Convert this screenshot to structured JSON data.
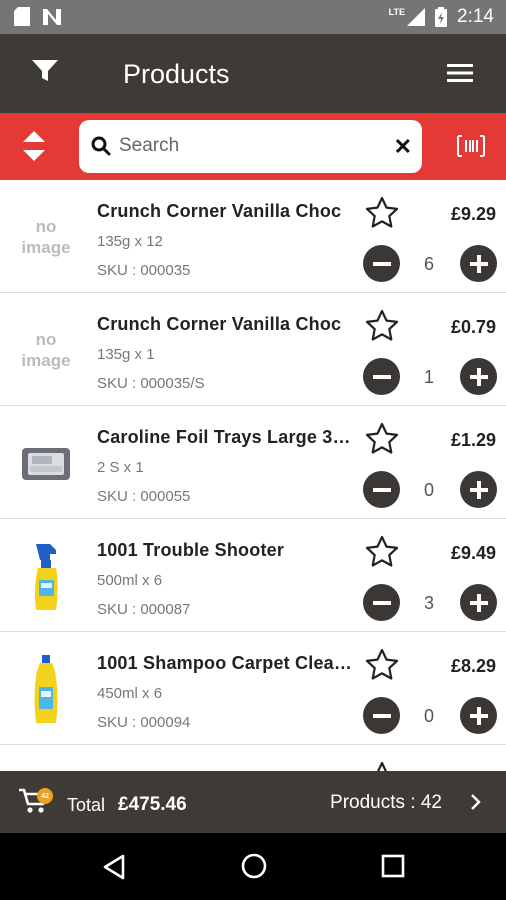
{
  "status_bar": {
    "network_label": "LTE",
    "time": "2:14"
  },
  "app_bar": {
    "title": "Products",
    "filter_icon": "filter-icon",
    "menu_icon": "hamburger-menu-icon"
  },
  "search": {
    "placeholder": "Search",
    "value": ""
  },
  "products": [
    {
      "name": "Crunch Corner Vanilla Choc",
      "size": "135g x 12",
      "sku": "SKU : 000035",
      "price": "£9.29",
      "qty": "6",
      "image": "no-image",
      "no_image_text": "no image"
    },
    {
      "name": "Crunch Corner Vanilla Choc",
      "size": "135g x 1",
      "sku": "SKU : 000035/S",
      "price": "£0.79",
      "qty": "1",
      "image": "no-image",
      "no_image_text": "no image"
    },
    {
      "name": "Caroline Foil Trays Large 37…",
      "size": "2 S x 1",
      "sku": "SKU : 000055",
      "price": "£1.29",
      "qty": "0",
      "image": "foil-tray"
    },
    {
      "name": "1001 Trouble Shooter",
      "size": "500ml x 6",
      "sku": "SKU : 000087",
      "price": "£9.49",
      "qty": "3",
      "image": "spray-bottle"
    },
    {
      "name": "1001 Shampoo Carpet Clea…",
      "size": "450ml x 6",
      "sku": "SKU : 000094",
      "price": "£8.29",
      "qty": "0",
      "image": "shampoo-bottle"
    }
  ],
  "footer": {
    "cart_badge": "42",
    "total_label": "Total",
    "total_value": "£475.46",
    "products_label": "Products : 42"
  },
  "colors": {
    "primary": "#3e3a35",
    "accent": "#e53935",
    "badge": "#f0a020"
  }
}
